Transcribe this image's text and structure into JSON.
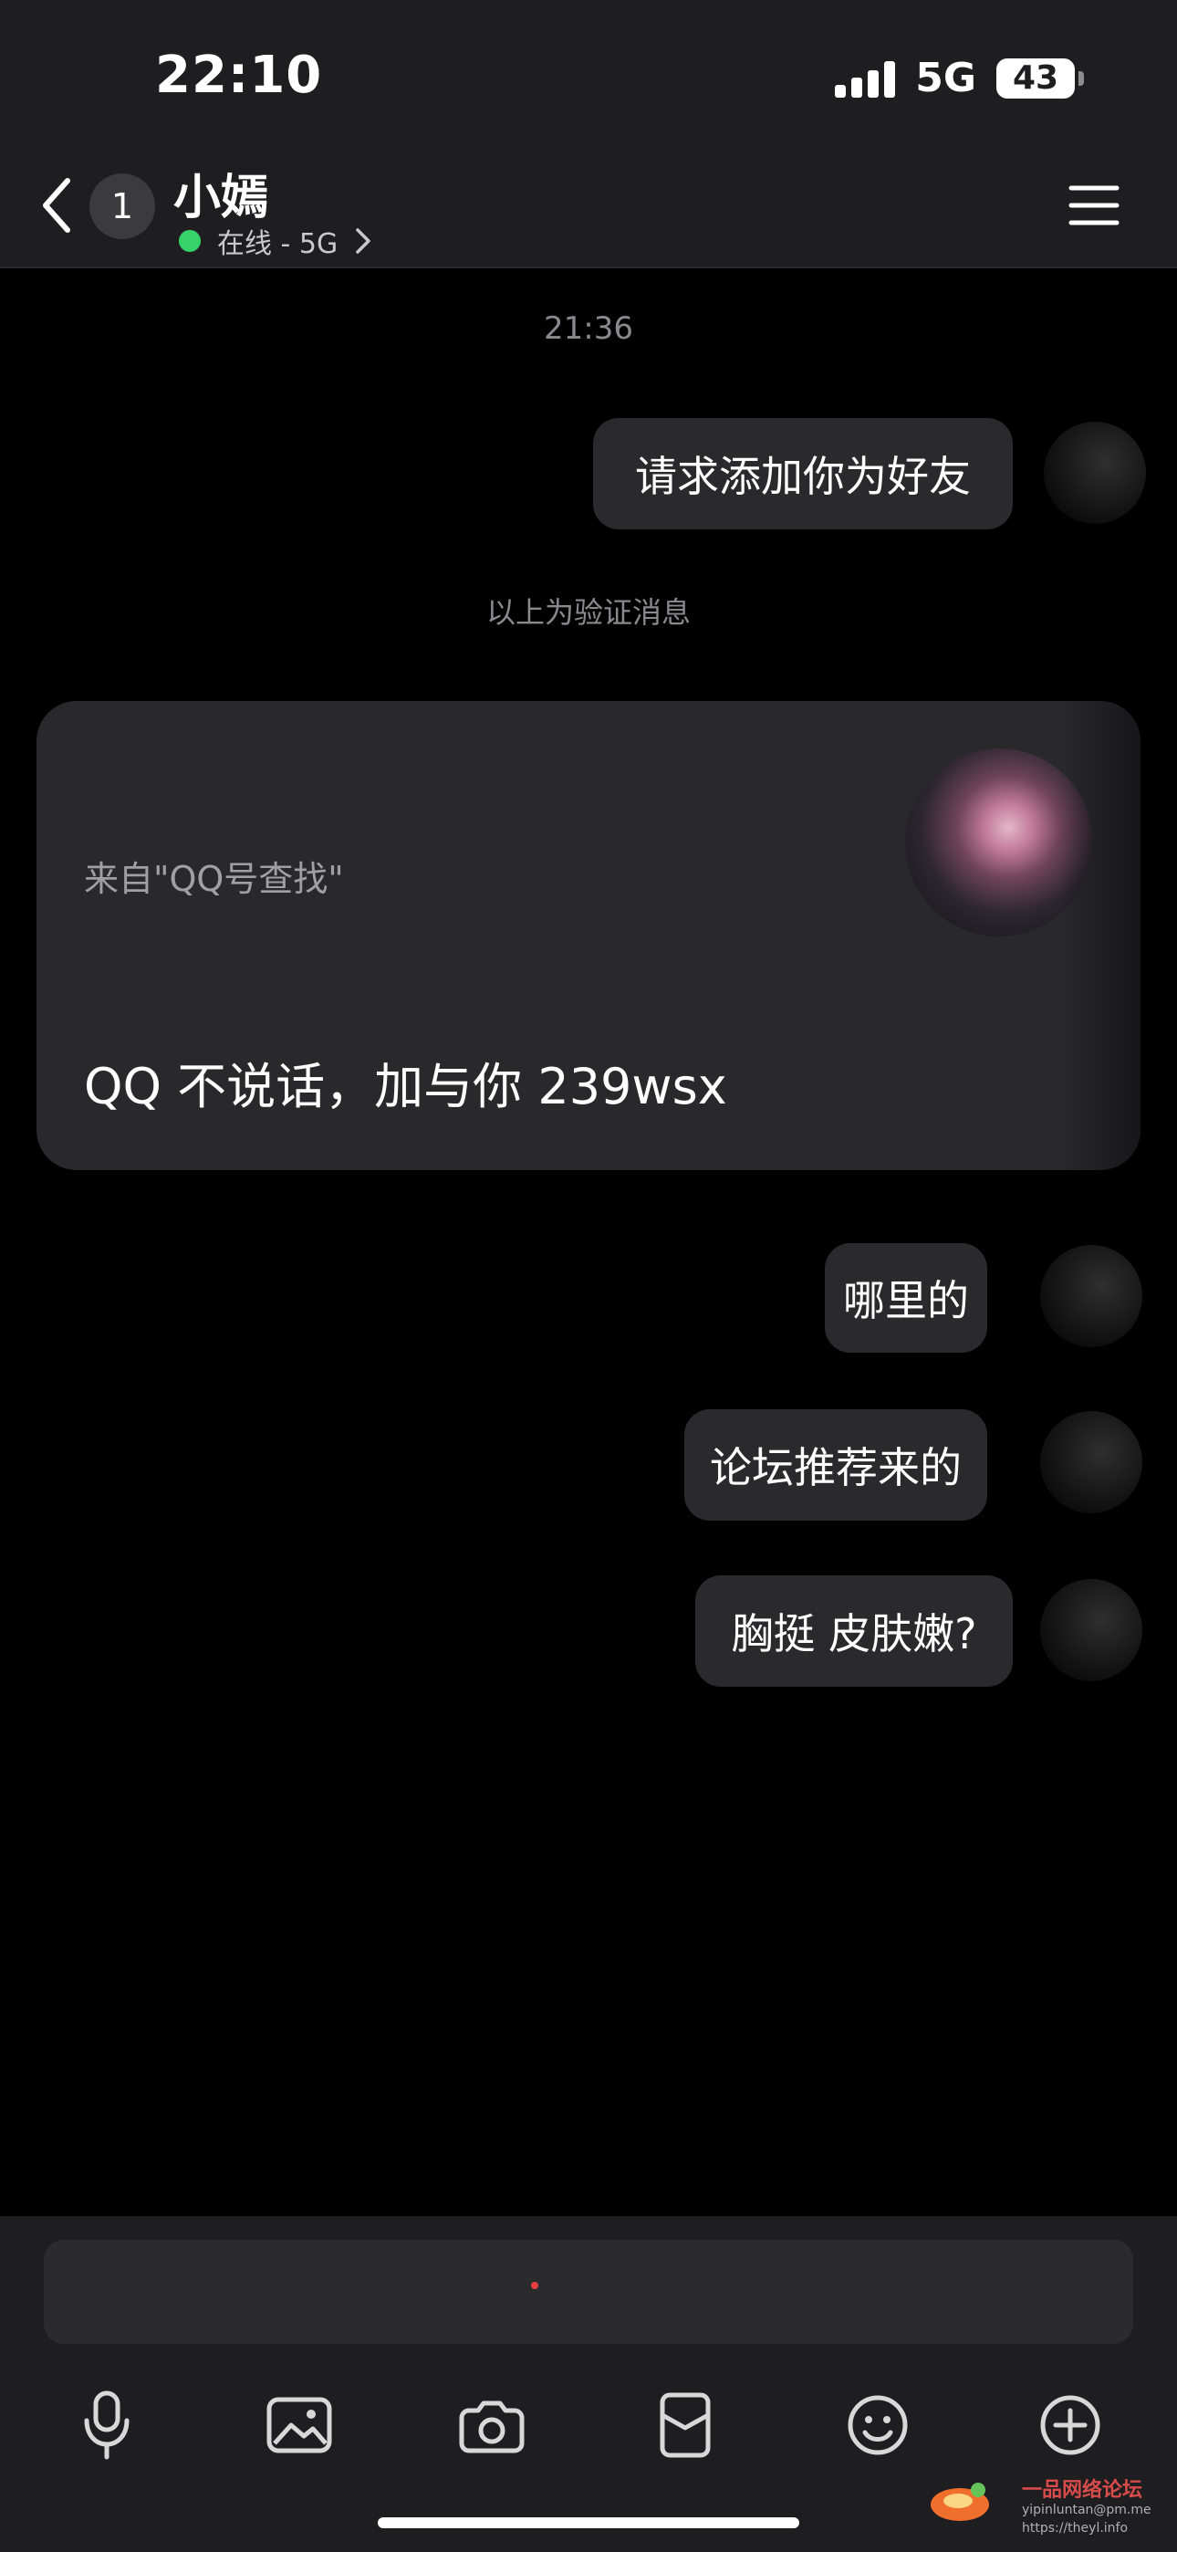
{
  "status_bar": {
    "time": "22:10",
    "network": "5G",
    "battery": "43"
  },
  "header": {
    "unread_count": "1",
    "contact_name": "小嫣",
    "presence_text": "在线 - 5G"
  },
  "chat": {
    "timestamp": "21:36",
    "system_note": "以上为验证消息",
    "request_card": {
      "source": "来自\"QQ号查找\"",
      "message": "QQ 不说话，加与你 239wsx"
    },
    "messages": [
      {
        "text": "请求添加你为好友"
      },
      {
        "text": "哪里的"
      },
      {
        "text": "论坛推荐来的"
      },
      {
        "text": "胸挺 皮肤嫩?"
      }
    ]
  },
  "input": {
    "placeholder": ""
  },
  "icons": {
    "back": "chevron-left-icon",
    "menu": "menu-icon",
    "mic": "microphone-icon",
    "image": "image-icon",
    "camera": "camera-icon",
    "red_packet": "red-packet-icon",
    "emoji": "emoji-icon",
    "plus": "plus-icon"
  },
  "watermark": {
    "title": "一品网络论坛",
    "line1": "yipinluntan@pm.me",
    "line2": "https://theyl.info"
  },
  "colors": {
    "background": "#000000",
    "panel": "#1e1e20",
    "bubble": "#2a2a2d",
    "presence": "#38d46b",
    "muted_text": "#8a8a8d"
  }
}
